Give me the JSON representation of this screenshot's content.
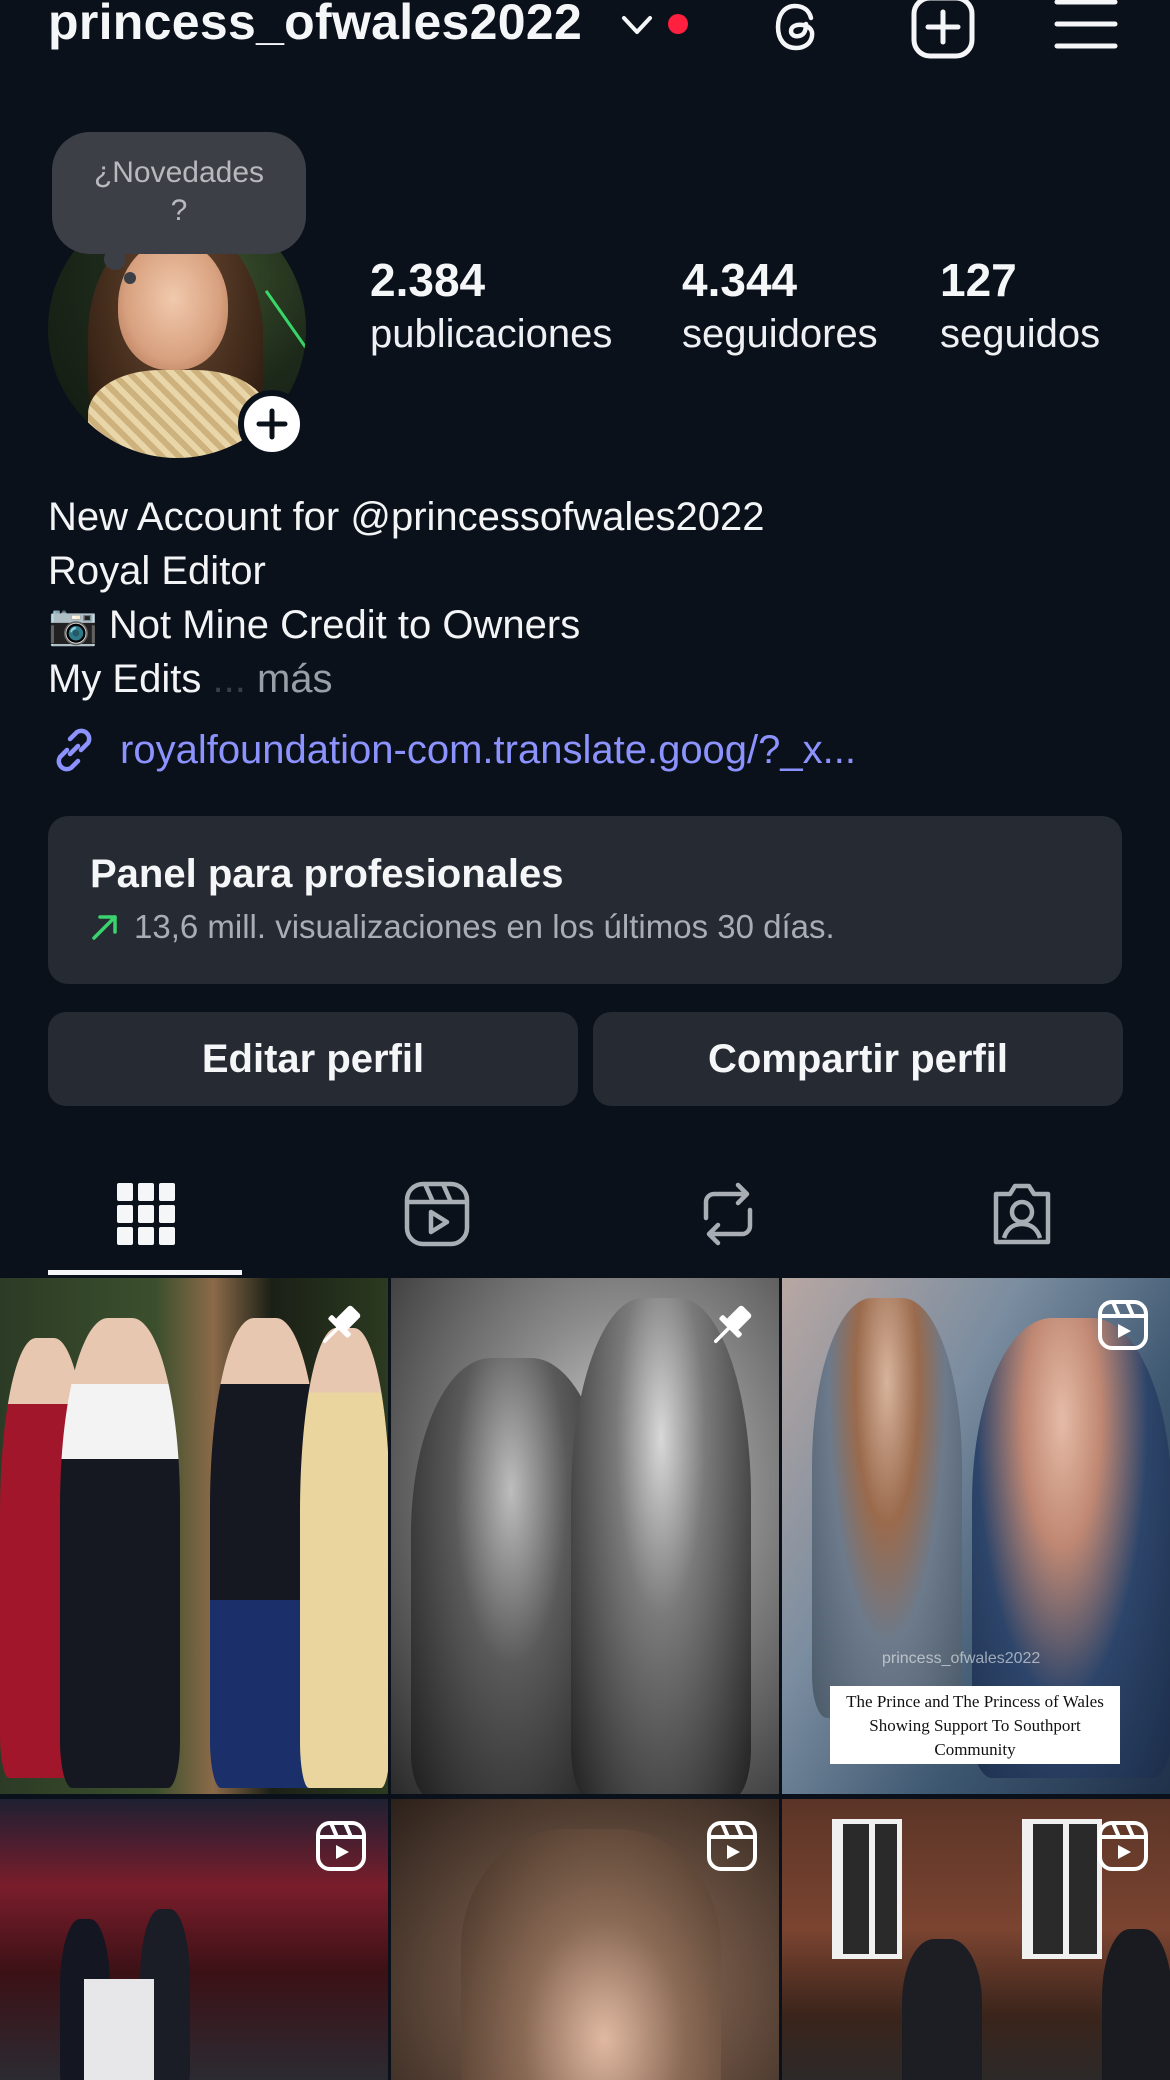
{
  "header": {
    "username": "princess_ofwales2022",
    "icons": [
      "chevron-down-icon",
      "threads-icon",
      "add-post-icon",
      "menu-icon"
    ],
    "notification_color": "#ff1f3f"
  },
  "note": {
    "text_line1": "¿Novedades",
    "text_line2": "?"
  },
  "stats": [
    {
      "value": "2.384",
      "label": "publicaciones"
    },
    {
      "value": "4.344",
      "label": "seguidores"
    },
    {
      "value": "127",
      "label": "seguidos"
    }
  ],
  "bio": {
    "line1": "New Account for @princessofwales2022",
    "line2": "Royal Editor",
    "line3": "📷 Not Mine Credit to Owners",
    "line4": "My Edits",
    "ellipsis": "...",
    "more": "más",
    "link": "royalfoundation-com.translate.goog/?_x..."
  },
  "dashboard": {
    "title": "Panel para profesionales",
    "subtitle": "13,6 mill. visualizaciones en los últimos 30 días."
  },
  "buttons": {
    "edit": "Editar perfil",
    "share": "Compartir perfil"
  },
  "tabs": [
    "grid-icon",
    "reels-icon",
    "reposts-icon",
    "tagged-icon"
  ],
  "posts": [
    {
      "type": "pinned"
    },
    {
      "type": "pinned"
    },
    {
      "type": "reel",
      "watermark": "princess_ofwales2022",
      "caption": "The Prince and The Princess of Wales Showing Support To Southport Community"
    },
    {
      "type": "reel"
    },
    {
      "type": "reel"
    },
    {
      "type": "reel"
    }
  ],
  "colors": {
    "background": "#0b111b",
    "surface": "#262a33",
    "link": "#8c93ff",
    "trend_up": "#3ad36d"
  }
}
